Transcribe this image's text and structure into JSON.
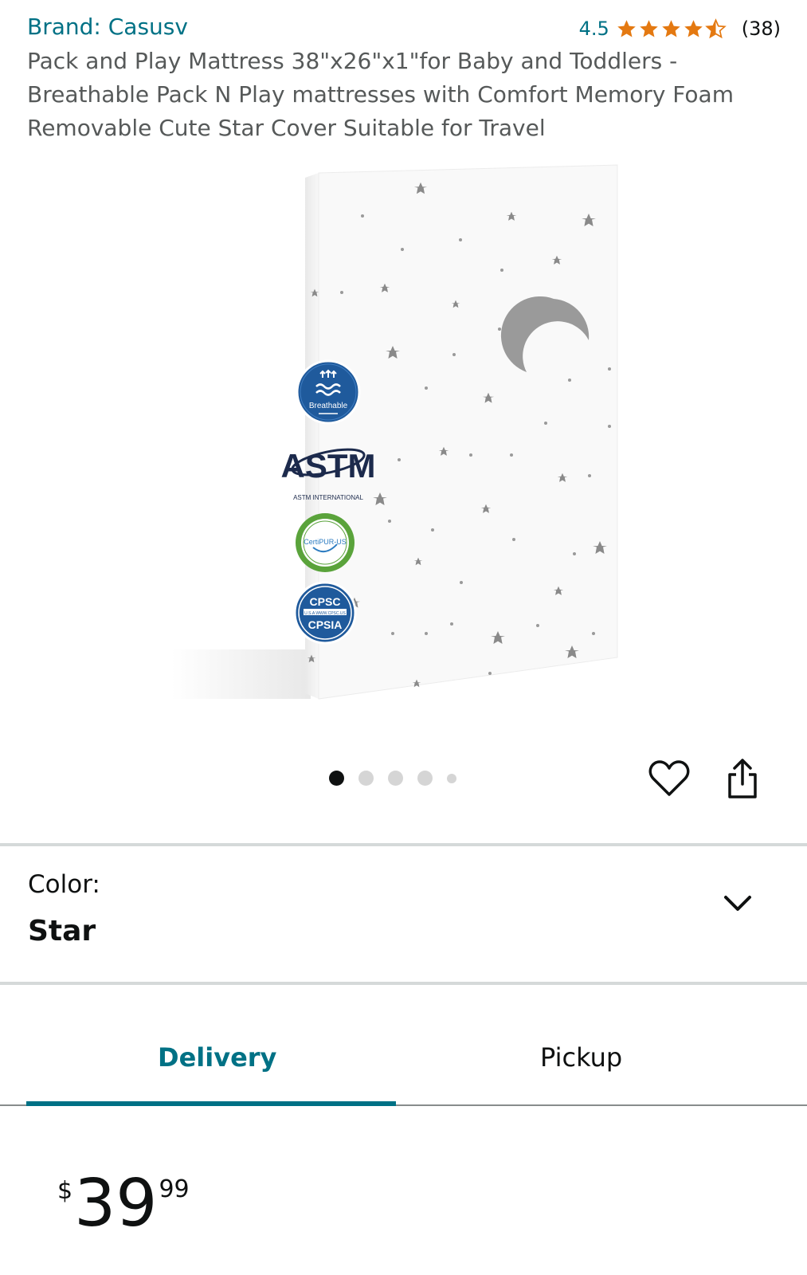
{
  "header": {
    "brand_link": "Brand: Casusv",
    "rating_value": "4.5",
    "rating_stars": 4.5,
    "rating_count": "(38)",
    "title": "Pack and Play Mattress 38\"x26\"x1\"for Baby and Toddlers - Breathable Pack N Play mattresses with Comfort Memory Foam Removable Cute Star Cover Suitable for Travel"
  },
  "gallery": {
    "image_count": 5,
    "active_index": 0,
    "badges": {
      "breathable": "Breathable",
      "astm": "ASTM",
      "astm_sub": "ASTM INTERNATIONAL",
      "certipur": "CertiPUR-US",
      "cpsc": "CPSC",
      "cpsc_url": "U.S.A WWW.CPSC.US",
      "cpsia": "CPSIA"
    },
    "icons": {
      "wishlist": "heart-icon",
      "share": "share-icon"
    }
  },
  "variation": {
    "label": "Color:",
    "value": "Star"
  },
  "tabs": {
    "delivery": "Delivery",
    "pickup": "Pickup",
    "active": "Delivery"
  },
  "price": {
    "symbol": "$",
    "whole": "39",
    "fraction": "99"
  },
  "colors": {
    "link": "#007185",
    "star": "#e47911",
    "text": "#0f1111",
    "muted": "#565959"
  }
}
